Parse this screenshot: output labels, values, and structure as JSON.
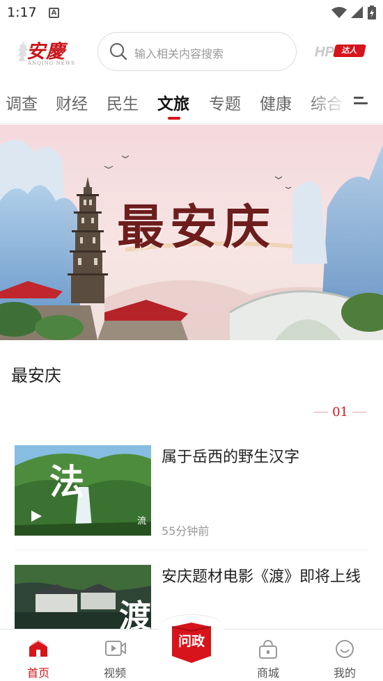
{
  "status_bar": {
    "time": "1:17",
    "notification_letter": "A"
  },
  "header": {
    "logo_text": "安慶",
    "logo_sub": "ANQING NEWS",
    "search_placeholder": "输入相关内容搜索",
    "hp_text": "HP",
    "hp_badge": "达人"
  },
  "tabs": [
    {
      "label": "调查",
      "active": false
    },
    {
      "label": "财经",
      "active": false
    },
    {
      "label": "民生",
      "active": false
    },
    {
      "label": "文旅",
      "active": true
    },
    {
      "label": "专题",
      "active": false
    },
    {
      "label": "健康",
      "active": false
    },
    {
      "label": "综合",
      "active": false
    }
  ],
  "banner": {
    "title": "最安庆"
  },
  "section": {
    "title": "最安庆",
    "page_number": "01"
  },
  "news": [
    {
      "title": "属于岳西的野生汉字",
      "time": "55分钟前",
      "thumb_char": "法",
      "thumb_small": "流"
    },
    {
      "title": "安庆题材电影《渡》即将上线",
      "thumb_char": "渡"
    }
  ],
  "bottom_nav": {
    "items": [
      {
        "label": "首页",
        "icon": "home-icon",
        "active": true
      },
      {
        "label": "视频",
        "icon": "video-icon",
        "active": false
      },
      {
        "label": "问政",
        "icon": "wenzheng-icon",
        "active": false
      },
      {
        "label": "商城",
        "icon": "shop-icon",
        "active": false
      },
      {
        "label": "我的",
        "icon": "profile-icon",
        "active": false
      }
    ]
  },
  "colors": {
    "accent": "#d7141b",
    "banner_text": "#6e1d1d"
  }
}
